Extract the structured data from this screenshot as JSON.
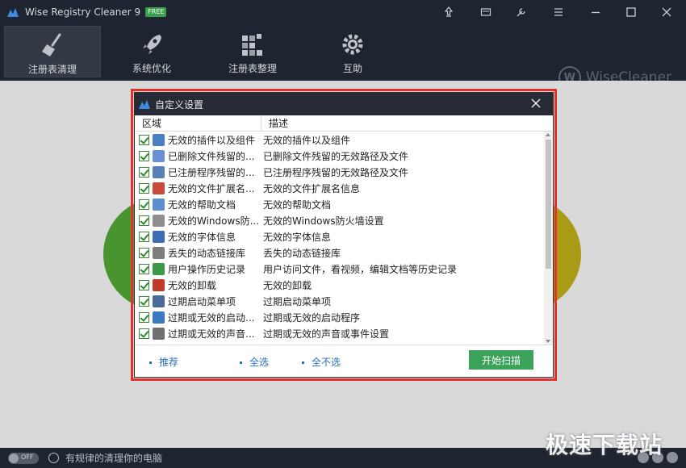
{
  "app": {
    "title": "Wise Registry Cleaner 9",
    "badge": "FREE"
  },
  "window_controls": [
    "upgrade-icon",
    "skin-icon",
    "tools-icon",
    "menu-icon",
    "minimize-icon",
    "maximize-icon",
    "close-icon"
  ],
  "nav": {
    "items": [
      {
        "label": "注册表清理",
        "icon": "broom-icon",
        "active": true
      },
      {
        "label": "系统优化",
        "icon": "rocket-icon",
        "active": false
      },
      {
        "label": "注册表整理",
        "icon": "blocks-icon",
        "active": false
      },
      {
        "label": "互助",
        "icon": "gear-icon",
        "active": false
      }
    ],
    "brand": "WiseCleaner",
    "brand_mark": "W"
  },
  "dialog": {
    "title": "自定义设置",
    "columns": [
      "区域",
      "描述"
    ],
    "rows": [
      {
        "name": "无效的插件以及组件",
        "desc": "无效的插件以及组件",
        "icon_color": "#4a7fc1"
      },
      {
        "name": "已删除文件残留的...",
        "desc": "已删除文件残留的无效路径及文件",
        "icon_color": "#6b8fd6"
      },
      {
        "name": "已注册程序残留的...",
        "desc": "已注册程序残留的无效路径及文件",
        "icon_color": "#5a7fb8"
      },
      {
        "name": "无效的文件扩展名...",
        "desc": "无效的文件扩展名信息",
        "icon_color": "#c94a3a"
      },
      {
        "name": "无效的帮助文档",
        "desc": "无效的帮助文档",
        "icon_color": "#5b8fd0"
      },
      {
        "name": "无效的Windows防...",
        "desc": "无效的Windows防火墙设置",
        "icon_color": "#8e8e8e"
      },
      {
        "name": "无效的字体信息",
        "desc": "无效的字体信息",
        "icon_color": "#3a6fb5"
      },
      {
        "name": "丢失的动态链接库",
        "desc": "丢失的动态链接库",
        "icon_color": "#7d7d7d"
      },
      {
        "name": "用户操作历史记录",
        "desc": "用户访问文件，看视频，编辑文档等历史记录",
        "icon_color": "#3a9a4a"
      },
      {
        "name": "无效的卸载",
        "desc": "无效的卸载",
        "icon_color": "#c0392b"
      },
      {
        "name": "过期启动菜单项",
        "desc": "过期启动菜单项",
        "icon_color": "#4a6a9a"
      },
      {
        "name": "过期或无效的启动...",
        "desc": "过期或无效的启动程序",
        "icon_color": "#3a7ac0"
      },
      {
        "name": "过期或无效的声音...",
        "desc": "过期或无效的声音或事件设置",
        "icon_color": "#707070"
      }
    ],
    "footer": {
      "recommend": "推荐",
      "select_all": "全选",
      "select_none": "全不选",
      "start_scan": "开始扫描"
    }
  },
  "status": {
    "toggle": "OFF",
    "text": "有规律的清理你的电脑"
  },
  "watermark": "极速下载站",
  "colors": {
    "chrome": "#1f2530",
    "content_bg": "#d9d9d9",
    "highlight_frame": "#e2322b",
    "scan_button": "#3ba25a",
    "link": "#2a6fbf"
  }
}
